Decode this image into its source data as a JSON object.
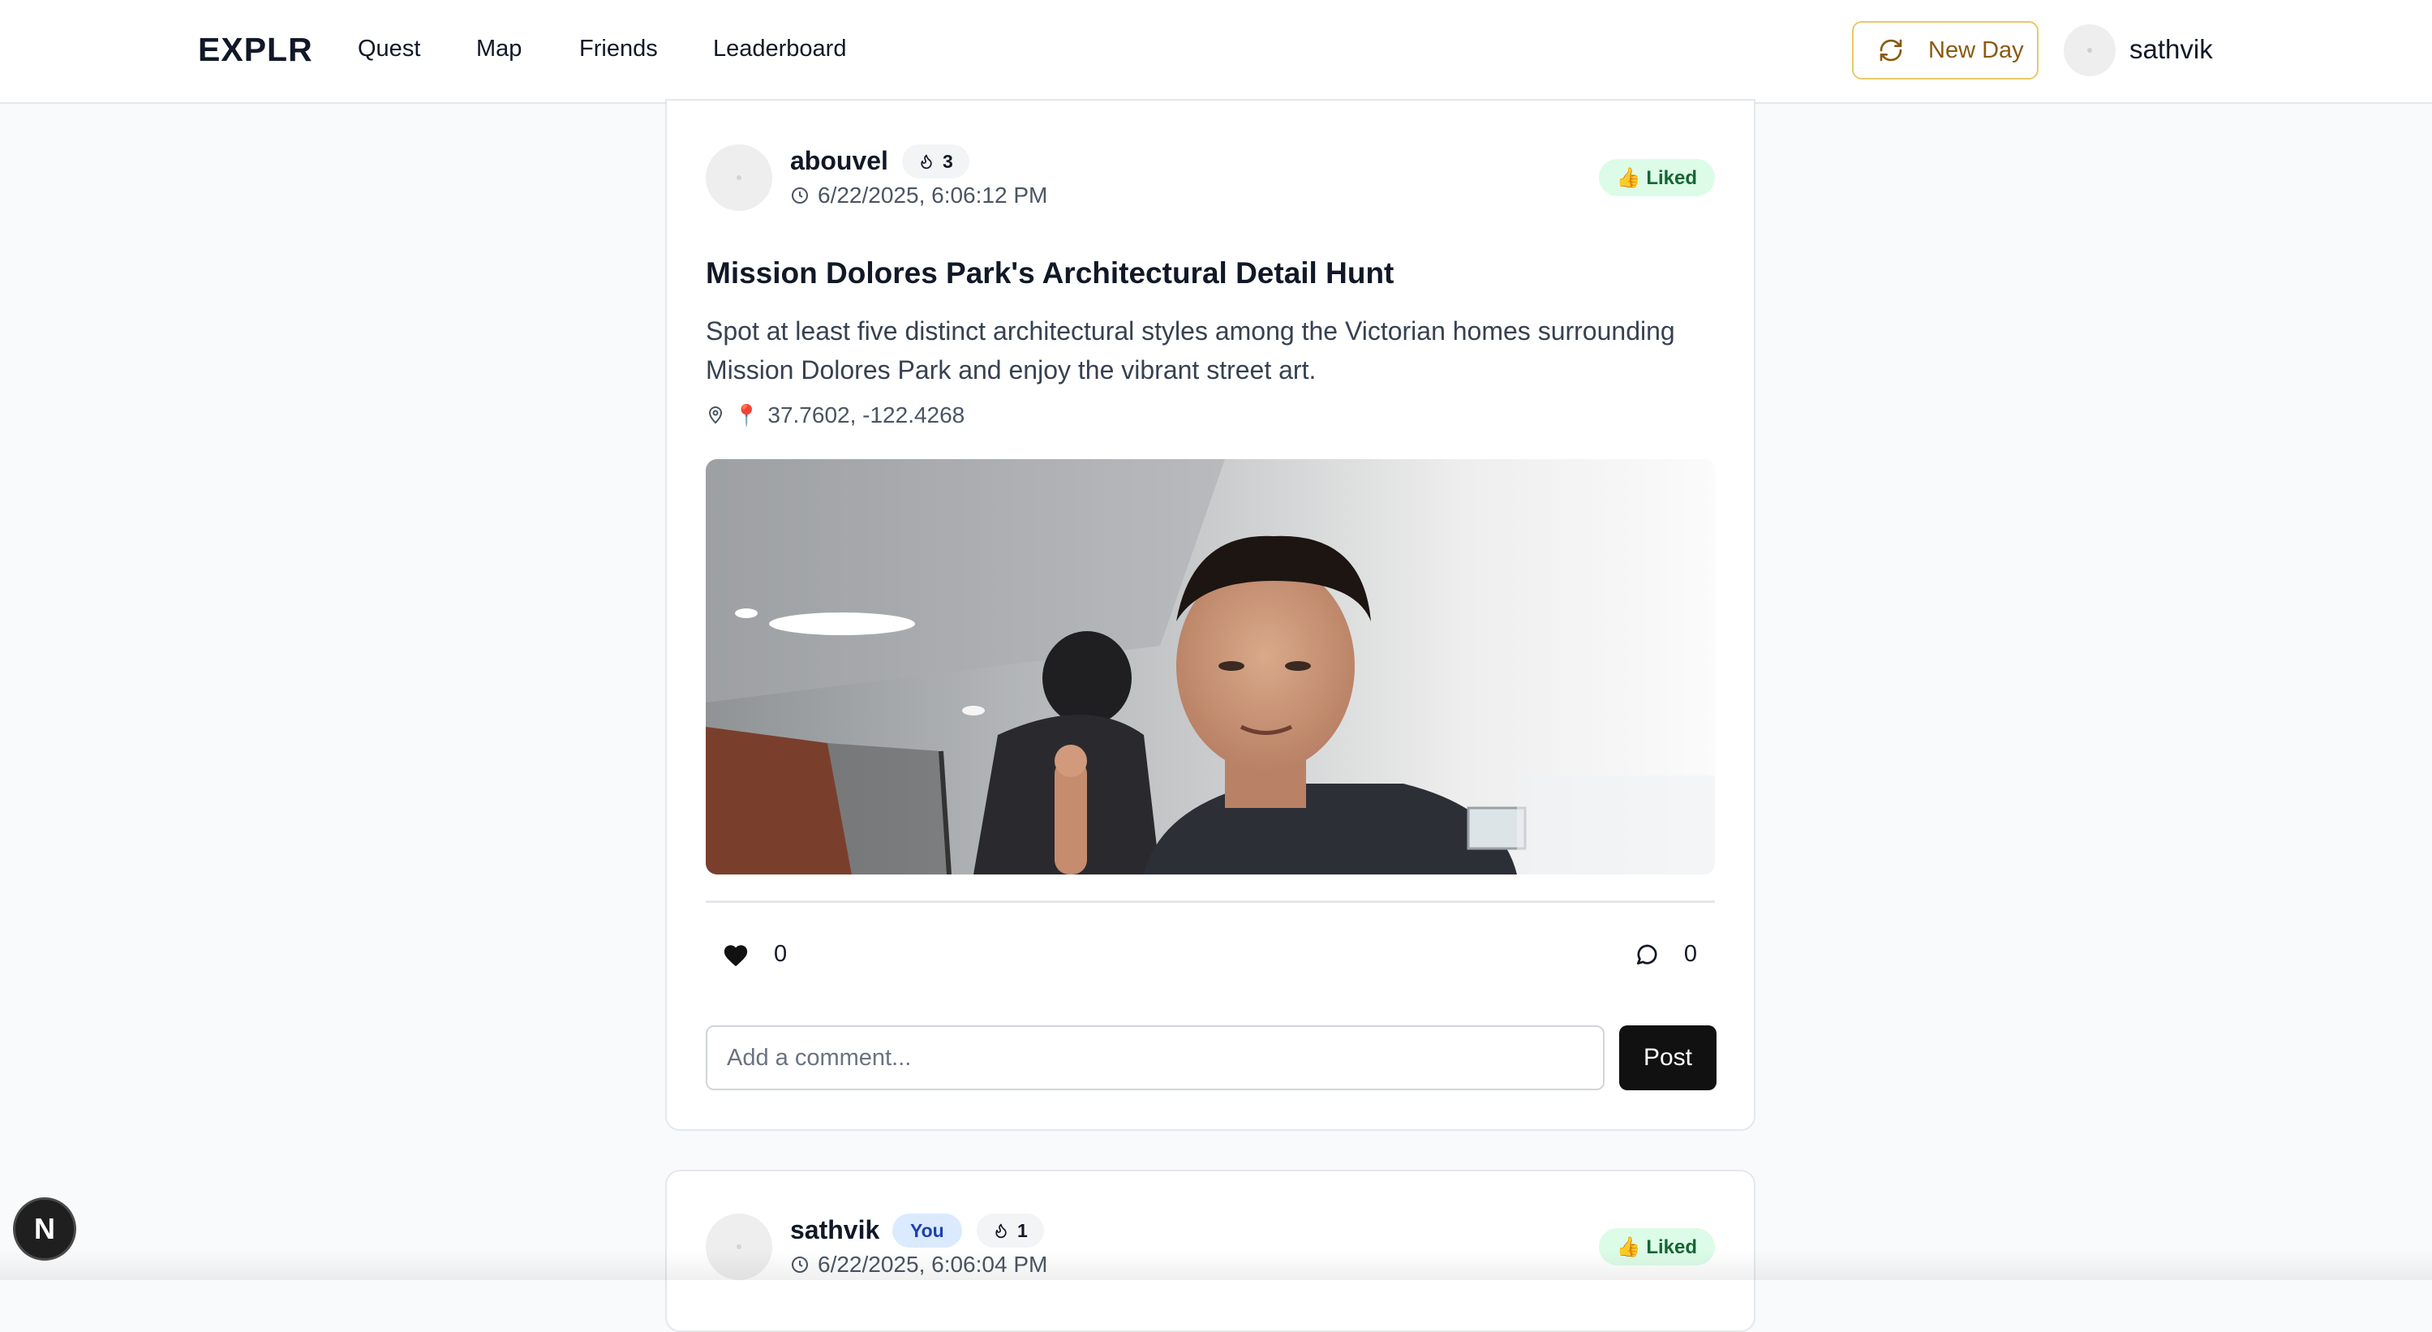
{
  "nav": {
    "brand": "EXPLR",
    "links": [
      "Quest",
      "Map",
      "Friends",
      "Leaderboard"
    ],
    "new_day_label": "New Day",
    "username": "sathvik"
  },
  "posts": [
    {
      "username": "abouvel",
      "streak": "3",
      "timestamp": "6/22/2025, 6:06:12 PM",
      "liked_label": "👍 Liked",
      "title": "Mission Dolores Park's Architectural Detail Hunt",
      "description": "Spot at least five distinct architectural styles among the Victorian homes surrounding Mission Dolores Park and enjoy the vibrant street art.",
      "location_pin": "📍",
      "coordinates": "37.7602, -122.4268",
      "likes": "0",
      "comments": "0",
      "comment_placeholder": "Add a comment...",
      "post_label": "Post"
    },
    {
      "username": "sathvik",
      "you_badge": "You",
      "streak": "1",
      "timestamp": "6/22/2025, 6:06:04 PM",
      "liked_label": "👍 Liked"
    }
  ],
  "dev_indicator": "N",
  "colors": {
    "accent_newday_border": "#e8c96a",
    "accent_newday_text": "#8a5a12",
    "liked_bg": "#dcfce7",
    "liked_text": "#166534",
    "you_bg": "#dbeafe",
    "you_text": "#1e40af",
    "post_button": "#111111"
  }
}
